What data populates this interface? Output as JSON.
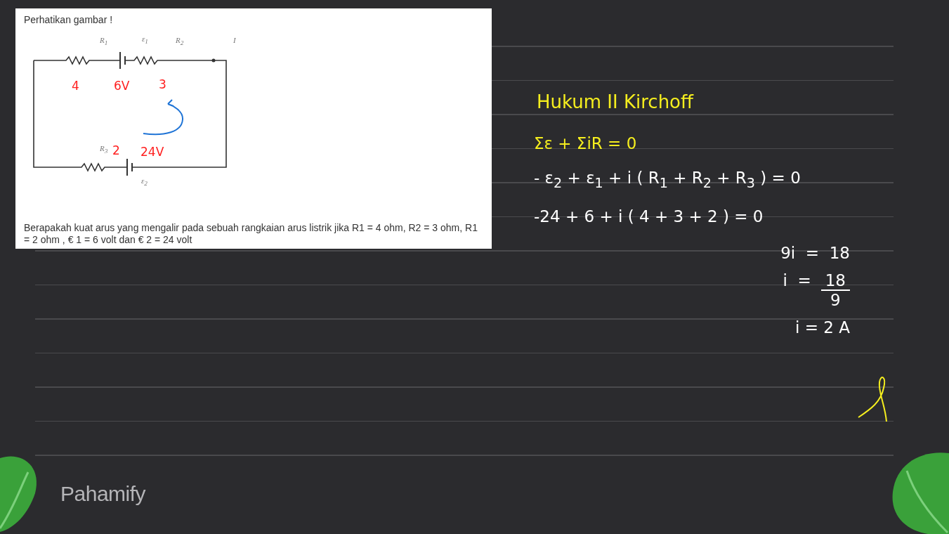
{
  "card": {
    "heading": "Perhatikan gambar !",
    "circuit_labels": [
      "R$_{1}$",
      "ε$_{1}$",
      "R$_{2}$",
      "I",
      "R$_{3}$",
      "ε$_{2}$"
    ],
    "annotations": [
      {
        "text": "4",
        "color": "#ff2020"
      },
      {
        "text": "6V",
        "color": "#ff2020"
      },
      {
        "text": "3",
        "color": "#ff2020"
      },
      {
        "text": "2",
        "color": "#ff2020"
      },
      {
        "text": "24V",
        "color": "#ff2020"
      }
    ],
    "question": "Berapakah kuat arus yang mengalir pada sebuah rangkaian arus listrik jika R1 = 4 ohm, R2 = 3 ohm, R1 = 2 ohm , € 1 = 6  volt dan € 2 = 24 volt"
  },
  "solution": {
    "title": "Hukum II Kirchoff",
    "lines": [
      {
        "kind": "equation",
        "color": "#f5ee1e",
        "text": "Σε + ΣiR = 0"
      },
      {
        "kind": "equation",
        "color": "#ffffff",
        "text": "- ε$_{2}$ + ε$_{1}$ + i ( R$_{1}$ + R$_{2}$ + R$_{3}$ ) = 0"
      },
      {
        "kind": "equation",
        "color": "#ffffff",
        "text": "-24 + 6 + i ( 4 + 3 + 2 ) = 0"
      },
      {
        "kind": "result",
        "color": "#ffffff",
        "text": "9i  =  18"
      },
      {
        "kind": "fraction",
        "color": "#ffffff",
        "left": "i  =",
        "numerator": "18",
        "denominator": "9"
      },
      {
        "kind": "result",
        "color": "#ffffff",
        "text": "i = 2 A"
      }
    ]
  },
  "logo": "Pahamify"
}
